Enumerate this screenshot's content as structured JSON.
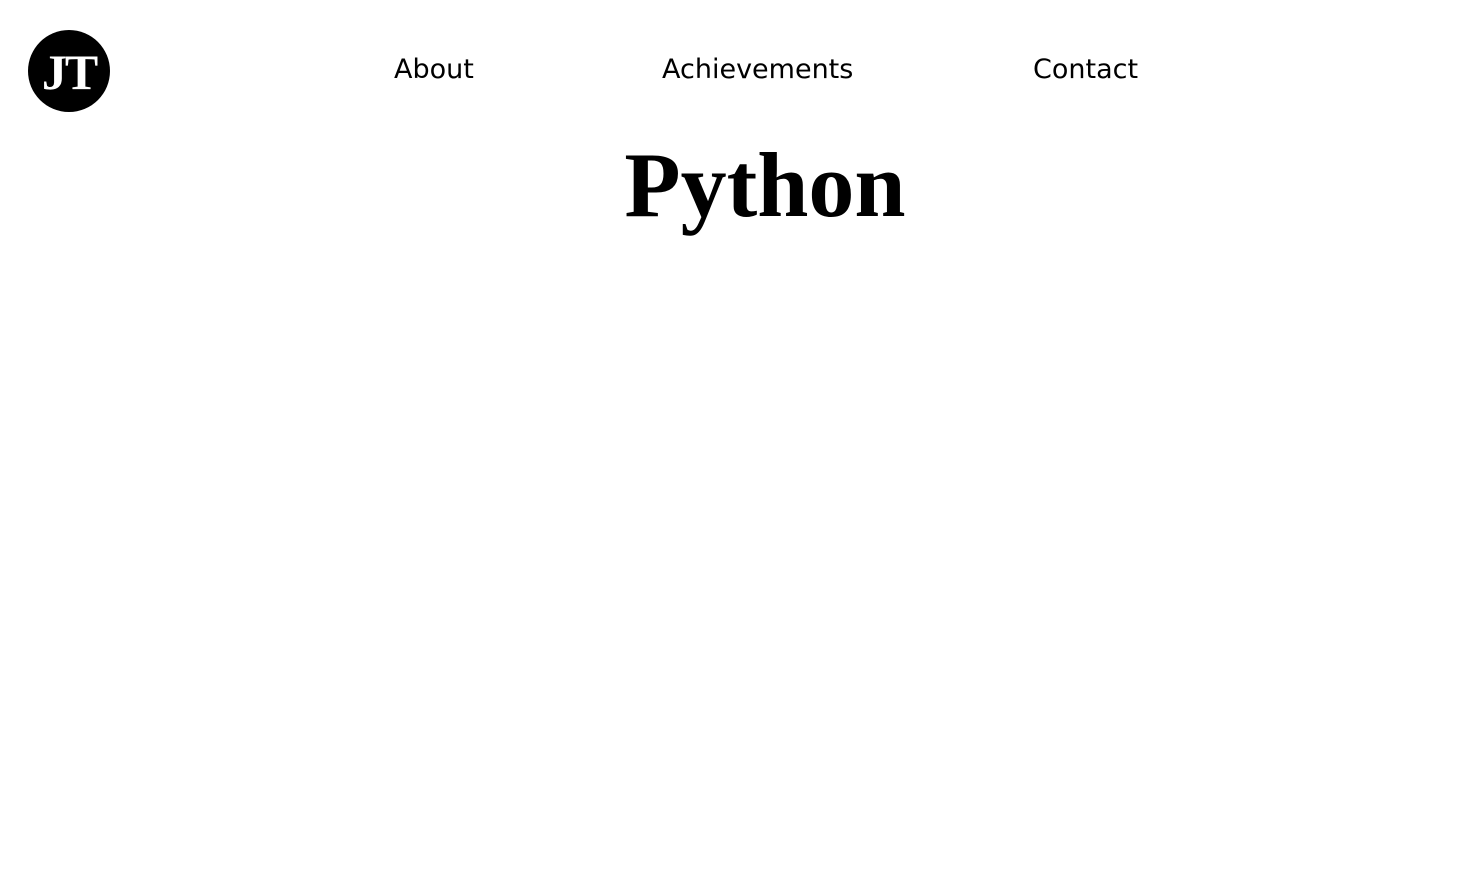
{
  "header": {
    "logo_text": "JT",
    "nav": {
      "about": "About",
      "achievements": "Achievements",
      "contact": "Contact"
    }
  },
  "main": {
    "title": "Python"
  },
  "colors": {
    "background": "#ffffff",
    "text": "#000000",
    "logo_background": "#000000",
    "logo_text": "#ffffff"
  }
}
